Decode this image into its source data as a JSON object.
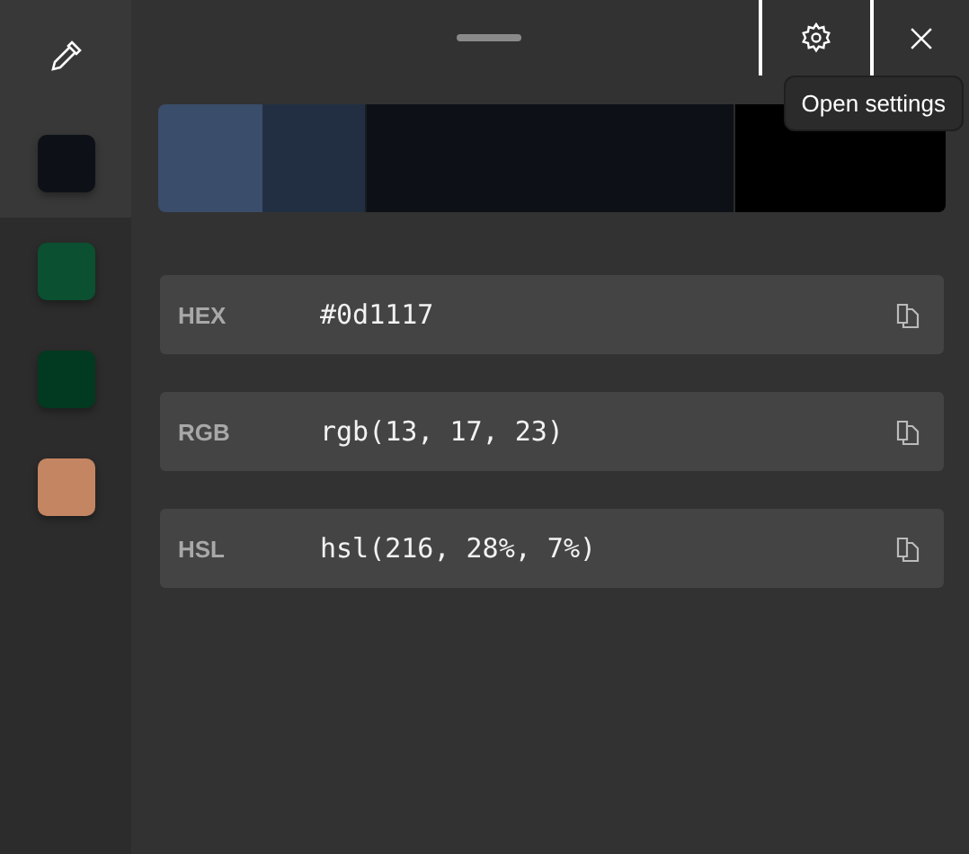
{
  "history": [
    {
      "color": "#0d1117",
      "selected": true
    },
    {
      "color": "#0b5030",
      "selected": false
    },
    {
      "color": "#013a20",
      "selected": false
    },
    {
      "color": "#c48562",
      "selected": false
    }
  ],
  "shades": [
    {
      "color": "#3a4d6a",
      "selected": false
    },
    {
      "color": "#222f42",
      "selected": false
    },
    {
      "color": "#0d1117",
      "selected": true
    },
    {
      "color": "#000000",
      "selected": false
    }
  ],
  "formats": [
    {
      "label": "HEX",
      "value": "#0d1117"
    },
    {
      "label": "RGB",
      "value": "rgb(13, 17, 23)"
    },
    {
      "label": "HSL",
      "value": "hsl(216, 28%, 7%)"
    }
  ],
  "tooltip": {
    "text": "Open settings"
  }
}
